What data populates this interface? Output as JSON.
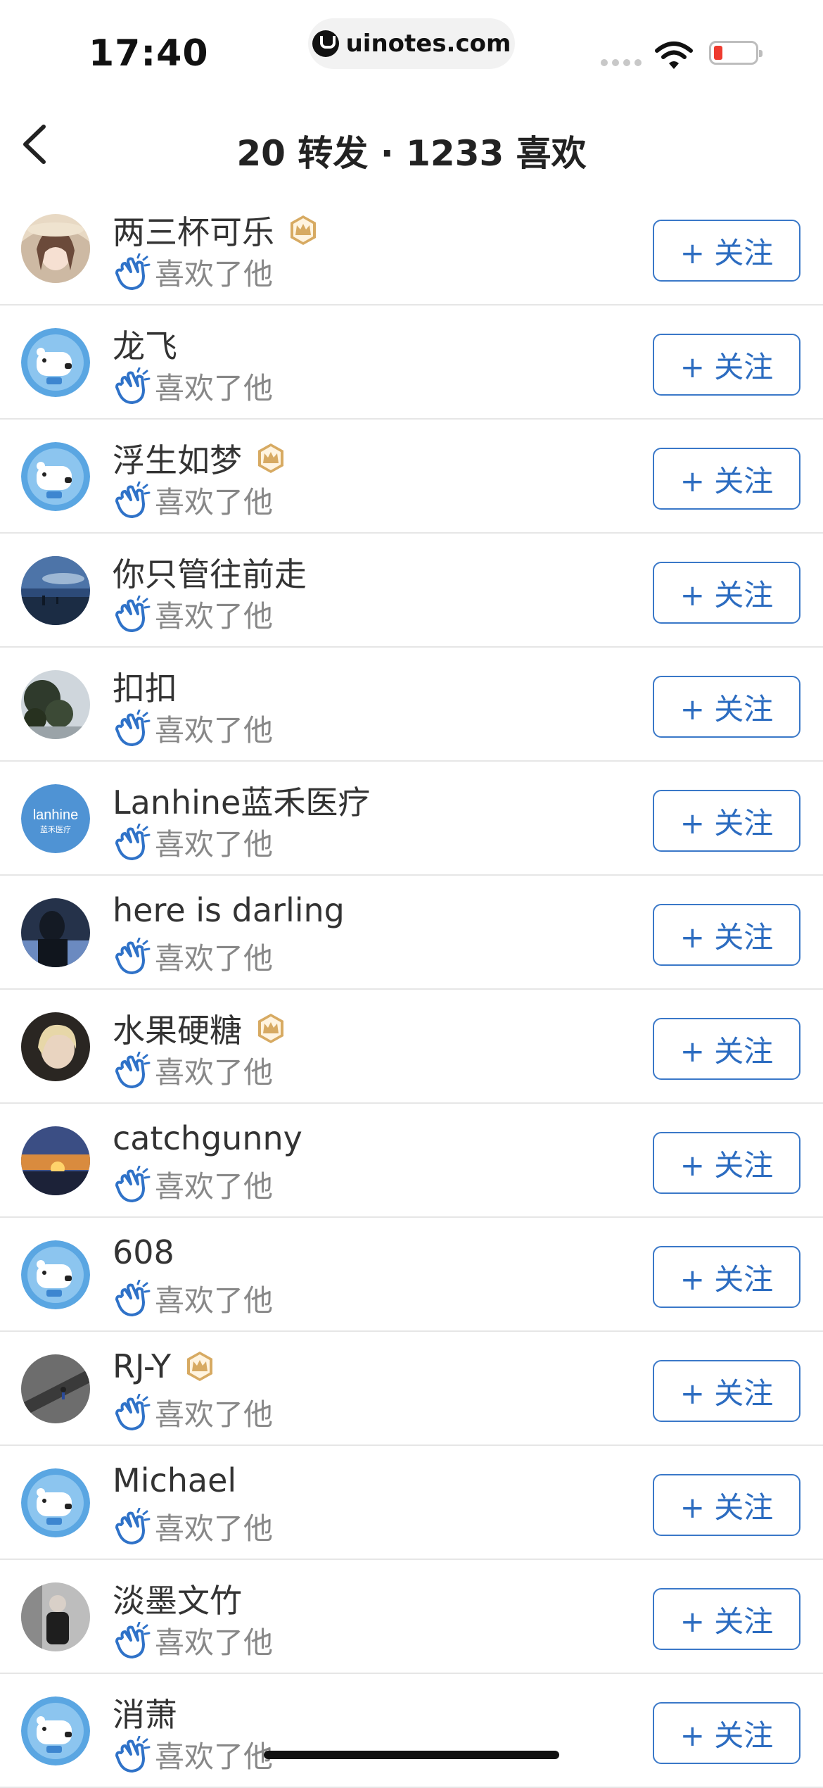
{
  "status_bar": {
    "time": "17:40",
    "url": "uinotes.com",
    "battery_color": "#ee3b2f"
  },
  "nav": {
    "back_icon": "chevron-left-icon",
    "title": "20 转发 · 1233 喜欢"
  },
  "colors": {
    "accent": "#2c6cc0",
    "crown": "#d7aa62",
    "divider": "#e6e6e6"
  },
  "liked_label": "喜欢了他",
  "follow_label": "+ 关注",
  "users": [
    {
      "name": "两三杯可乐",
      "badge": true,
      "avatar": "photo-woman"
    },
    {
      "name": "龙飞",
      "badge": false,
      "avatar": "default-bear"
    },
    {
      "name": "浮生如梦",
      "badge": true,
      "avatar": "default-bear"
    },
    {
      "name": "你只管往前走",
      "badge": false,
      "avatar": "photo-sky"
    },
    {
      "name": "扣扣",
      "badge": false,
      "avatar": "photo-tree"
    },
    {
      "name": "Lanhine蓝禾医疗",
      "badge": false,
      "avatar": "logo-lanhine"
    },
    {
      "name": "here is darling",
      "badge": false,
      "avatar": "photo-buddha"
    },
    {
      "name": "水果硬糖",
      "badge": true,
      "avatar": "photo-portrait"
    },
    {
      "name": "catchgunny",
      "badge": false,
      "avatar": "photo-sunset"
    },
    {
      "name": "608",
      "badge": false,
      "avatar": "default-bear"
    },
    {
      "name": "RJ-Y",
      "badge": true,
      "avatar": "photo-street"
    },
    {
      "name": "Michael",
      "badge": false,
      "avatar": "default-bear"
    },
    {
      "name": "淡墨文竹",
      "badge": false,
      "avatar": "photo-man"
    },
    {
      "name": "消萧",
      "badge": false,
      "avatar": "default-bear"
    }
  ]
}
